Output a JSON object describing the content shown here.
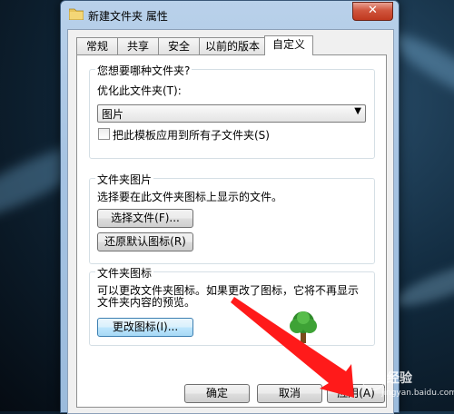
{
  "window": {
    "title": "新建文件夹 属性",
    "close_label": "✕"
  },
  "tabs": [
    "常规",
    "共享",
    "安全",
    "以前的版本",
    "自定义"
  ],
  "active_tab": "自定义",
  "group_folder_type": {
    "title": "您想要哪种文件夹?",
    "optimize_label": "优化此文件夹(T):",
    "optimize_value": "图片",
    "apply_template_label": "把此模板应用到所有子文件夹(S)",
    "apply_template_checked": false
  },
  "group_folder_picture": {
    "title": "文件夹图片",
    "description": "选择要在此文件夹图标上显示的文件。",
    "choose_file_button": "选择文件(F)...",
    "restore_default_button": "还原默认图标(R)"
  },
  "group_folder_icon": {
    "title": "文件夹图标",
    "description_line1": "可以更改文件夹图标。如果更改了图标，它将不再显示",
    "description_line2": "文件夹内容的预览。",
    "change_icon_button": "更改图标(I)..."
  },
  "buttons": {
    "ok": "确定",
    "cancel": "取消",
    "apply": "应用(A)"
  },
  "watermark": {
    "text": "经验",
    "url": "jingyan.baidu.com"
  },
  "colors": {
    "annotation_arrow": "#ff1a1a"
  }
}
